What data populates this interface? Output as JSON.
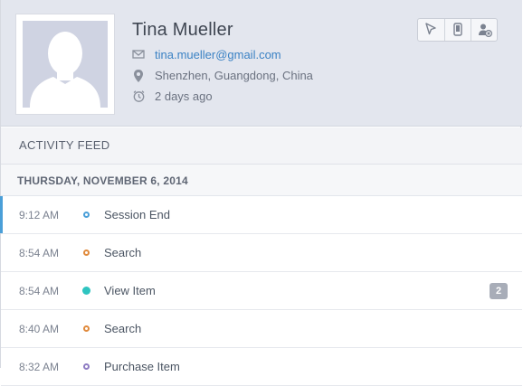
{
  "profile": {
    "name": "Tina Mueller",
    "email": "tina.mueller@gmail.com",
    "location": "Shenzhen, Guangdong, China",
    "last_seen": "2 days ago"
  },
  "toolbar": {
    "icons": [
      "cursor-icon",
      "phone-icon",
      "remove-user-icon"
    ]
  },
  "feed": {
    "title": "ACTIVITY FEED",
    "date": "THURSDAY, NOVEMBER 6, 2014",
    "items": [
      {
        "time": "9:12 AM",
        "label": "Session End",
        "dot_color": "#4a9fd8",
        "dot_style": "ring",
        "badge": null,
        "active": true
      },
      {
        "time": "8:54 AM",
        "label": "Search",
        "dot_color": "#e08a3c",
        "dot_style": "ring",
        "badge": null,
        "active": false
      },
      {
        "time": "8:54 AM",
        "label": "View Item",
        "dot_color": "#2ec4c0",
        "dot_style": "filled",
        "badge": "2",
        "active": false
      },
      {
        "time": "8:40 AM",
        "label": "Search",
        "dot_color": "#e08a3c",
        "dot_style": "ring",
        "badge": null,
        "active": false
      },
      {
        "time": "8:32 AM",
        "label": "Purchase Item",
        "dot_color": "#8e7cc3",
        "dot_style": "ring",
        "badge": null,
        "active": false
      }
    ]
  },
  "colors": {
    "accent": "#4a9fd8",
    "link": "#3b82c4",
    "header_bg": "#e3e6ee"
  }
}
